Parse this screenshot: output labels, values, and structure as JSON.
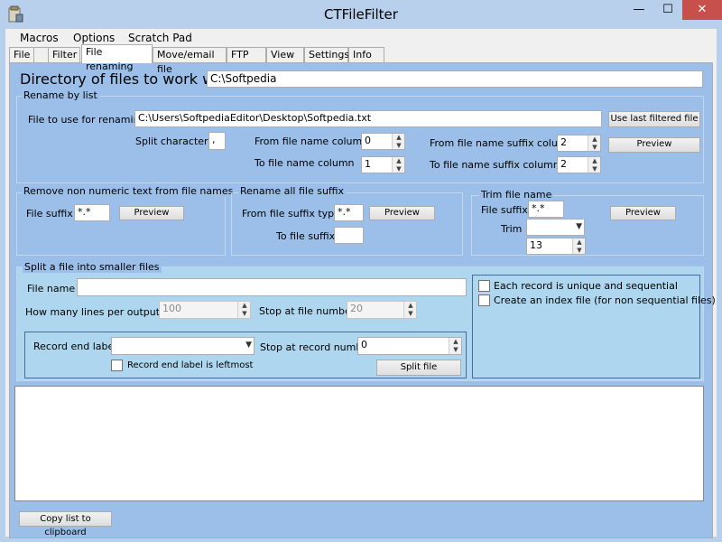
{
  "window": {
    "title": "CTFileFilter",
    "minimize_glyph": "—",
    "maximize_glyph": "☐",
    "close_glyph": "✕"
  },
  "menu": [
    "Macros",
    "Options",
    "Scratch Pad"
  ],
  "tabs": [
    "File",
    "Filter",
    "File renaming",
    "Move/email file",
    "FTP",
    "View",
    "Settings",
    "Info"
  ],
  "directory": {
    "label": "Directory of files to work with",
    "value": "C:\\Softpedia"
  },
  "rename_by_list": {
    "title": "Rename by list",
    "file_label": "File to use for renaming",
    "file_value": "C:\\Users\\SoftpediaEditor\\Desktop\\Softpedia.txt",
    "use_last_button": "Use last filtered file",
    "split_label": "Split character:",
    "split_value": ",",
    "from_col_label": "From file name column",
    "from_col_value": "0",
    "to_col_label": "To file name column",
    "to_col_value": "1",
    "from_suffix_label": "From file name suffix column",
    "from_suffix_value": "2",
    "to_suffix_label": "To file name suffix column",
    "to_suffix_value": "2",
    "preview_button": "Preview"
  },
  "remove_non_numeric": {
    "title": "Remove non numeric text from file names",
    "suffix_label": "File suffix",
    "suffix_value": "*.*",
    "preview_button": "Preview"
  },
  "rename_all_suffix": {
    "title": "Rename all file suffix",
    "from_label": "From file suffix types",
    "from_value": "*.*",
    "to_label": "To file suffix",
    "to_value": "",
    "preview_button": "Preview"
  },
  "trim_file_name": {
    "title": "Trim file name",
    "suffix_label": "File suffix",
    "suffix_value": "*.*",
    "trim_label": "Trim",
    "trim_value": "",
    "trim_number": "13",
    "preview_button": "Preview"
  },
  "split_file": {
    "title": "Split a file into smaller files",
    "file_name_label": "File name",
    "file_name_value": "",
    "lines_label": "How many lines per output file",
    "lines_value": "100",
    "stop_file_label": "Stop at file number",
    "stop_file_value": "20",
    "record_end_label": "Record end label",
    "record_end_value": "",
    "stop_record_label": "Stop at record number",
    "stop_record_value": "0",
    "leftmost_label": "Record end label is leftmost",
    "split_button": "Split file",
    "unique_label": "Each record is unique and sequential",
    "index_label": "Create an index file (for non sequential files)"
  },
  "copy_button": "Copy list to clipboard"
}
